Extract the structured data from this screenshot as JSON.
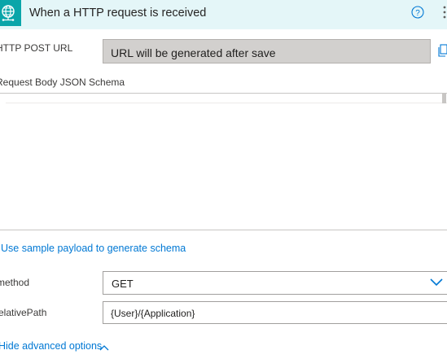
{
  "header": {
    "title": "When a HTTP request is received",
    "icon": "globe-network-icon",
    "help_icon": "help-circle-icon",
    "more_icon": "more-options-icon",
    "background": "#e4f6f8",
    "icon_color": "#0aa5a9"
  },
  "url": {
    "label": "HTTP POST URL",
    "label_visible": "HTTP POST URL",
    "value": "URL will be generated after save",
    "copy_icon": "copy-icon"
  },
  "schema": {
    "label": "Request Body JSON Schema",
    "content": ""
  },
  "sample_payload_link": "Use sample payload to generate schema",
  "method": {
    "label": "method",
    "value": "GET"
  },
  "relative_path": {
    "label": "relativePath",
    "value": "{User}/{Application}"
  },
  "advanced": {
    "label": "Hide advanced options"
  },
  "colors": {
    "link": "#0078d4",
    "disabled_field": "#d2d0ce"
  }
}
